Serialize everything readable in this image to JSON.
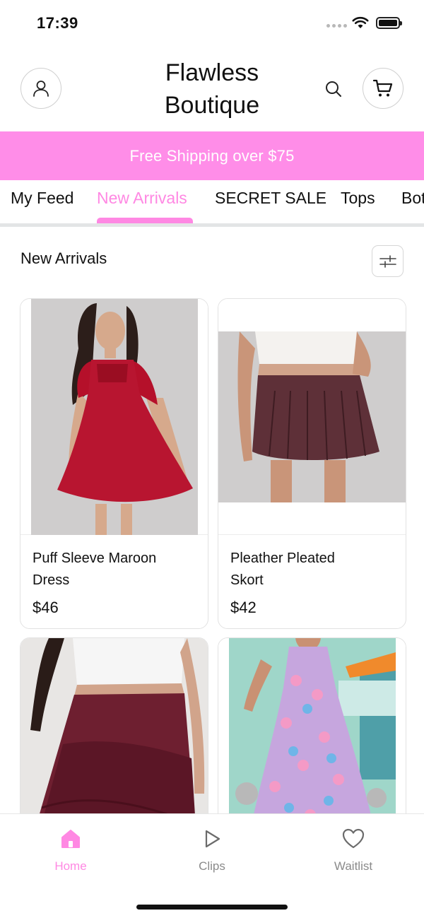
{
  "status_bar": {
    "time": "17:39"
  },
  "header": {
    "brand_line1": "Flawless",
    "brand_line2": "Boutique"
  },
  "promo": {
    "text": "Free Shipping over $75"
  },
  "tabs": [
    {
      "label": "My Feed",
      "active": false
    },
    {
      "label": "New Arrivals",
      "active": true
    },
    {
      "label": "SECRET SALE",
      "active": false
    },
    {
      "label": "Tops",
      "active": false
    },
    {
      "label": "Bot",
      "active": false
    }
  ],
  "section": {
    "title": "New Arrivals"
  },
  "products": [
    {
      "name_line1": "Puff Sleeve Maroon",
      "name_line2": "Dress",
      "price": "$46"
    },
    {
      "name_line1": "Pleather Pleated",
      "name_line2": "Skort",
      "price": "$42"
    },
    {
      "name_line1": "",
      "name_line2": "",
      "price": ""
    },
    {
      "name_line1": "",
      "name_line2": "",
      "price": ""
    }
  ],
  "bottom_nav": [
    {
      "label": "Home",
      "icon": "home-icon",
      "active": true
    },
    {
      "label": "Clips",
      "icon": "play-icon",
      "active": false
    },
    {
      "label": "Waitlist",
      "icon": "heart-icon",
      "active": false
    }
  ],
  "colors": {
    "accent_pink": "#ff88e3",
    "banner_pink": "#ff8de8"
  }
}
